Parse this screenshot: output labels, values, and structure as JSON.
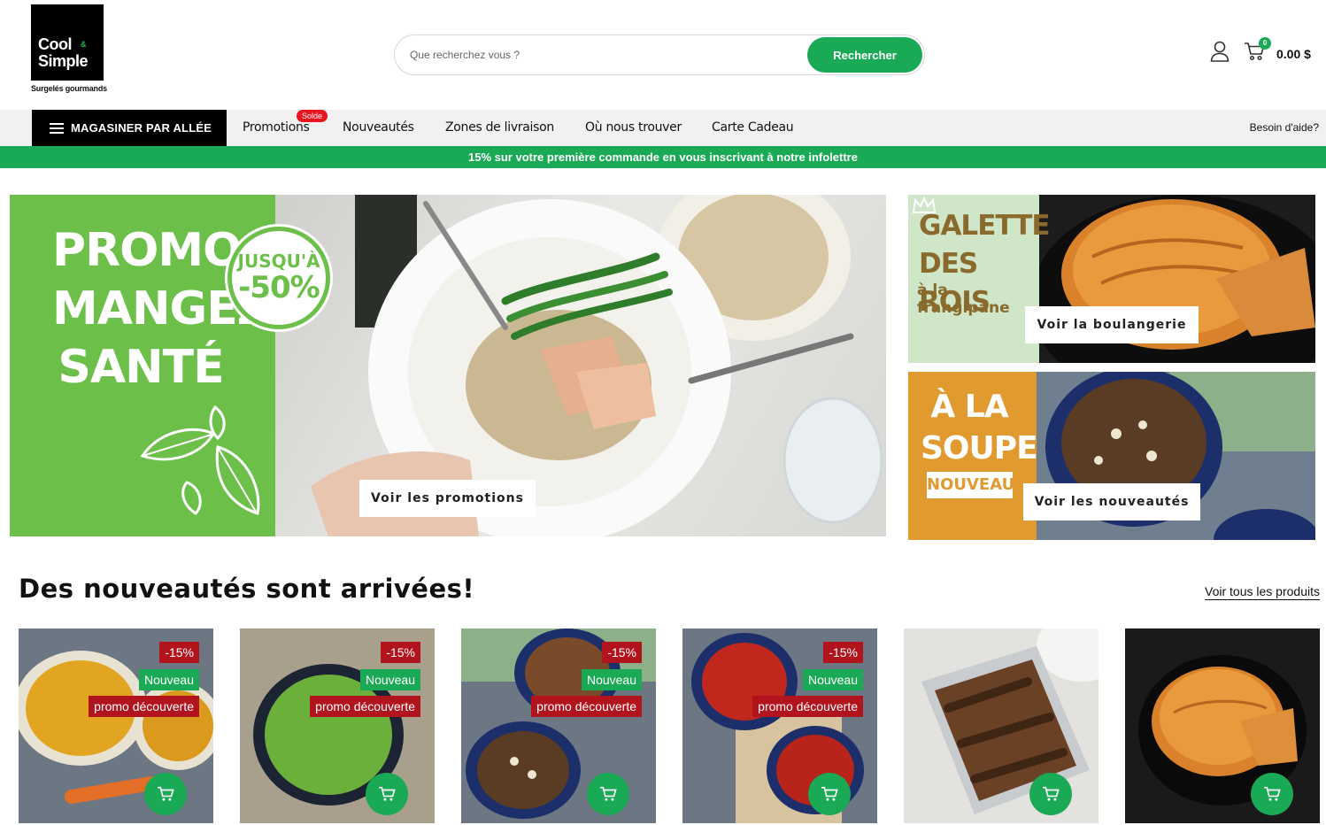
{
  "header": {
    "logo": {
      "line1": "Cool",
      "amp": "&",
      "line2": "Simple",
      "tagline": "Surgelés gourmands"
    },
    "search": {
      "placeholder": "Que recherchez vous ?",
      "button_label": "Rechercher"
    },
    "cart": {
      "count": "0",
      "total": "0.00 $"
    },
    "icons": {
      "account": "user-icon",
      "cart": "cart-icon",
      "menu": "hamburger-icon",
      "add_to_cart": "cart-icon"
    }
  },
  "nav": {
    "aisle_label": "MAGASINER PAR ALLÉE",
    "items": [
      {
        "label": "Promotions",
        "badge": "Solde"
      },
      {
        "label": "Nouveautés"
      },
      {
        "label": "Zones de livraison"
      },
      {
        "label": "Où nous trouver"
      },
      {
        "label": "Carte Cadeau"
      }
    ],
    "help_label": "Besoin d'aide?"
  },
  "promo_strip": "15% sur votre première commande en vous inscrivant à notre infolettre",
  "banners": {
    "main": {
      "title_lines": [
        "PROMOS",
        "MANGEZ",
        "SANTÉ"
      ],
      "circle_line1": "JUSQU'À",
      "circle_line2": "-50%",
      "button_label": "Voir les promotions"
    },
    "bakery": {
      "title_lines": [
        "GALETTE",
        "DES ROIS"
      ],
      "subtitle": "à la frangipane",
      "button_label": "Voir la boulangerie"
    },
    "soup": {
      "title_lines": [
        "À LA",
        "SOUPE!"
      ],
      "badge": "NOUVEAU",
      "button_label": "Voir les nouveautés"
    }
  },
  "section": {
    "title": "Des nouveautés sont arrivées!",
    "see_all_label": "Voir tous les produits"
  },
  "products": [
    {
      "discount": "-15%",
      "new_label": "Nouveau",
      "promo_label": "promo découverte",
      "bg": "#e2a521"
    },
    {
      "discount": "-15%",
      "new_label": "Nouveau",
      "promo_label": "promo découverte",
      "bg": "#6ab03a"
    },
    {
      "discount": "-15%",
      "new_label": "Nouveau",
      "promo_label": "promo découverte",
      "bg": "#5a3b24"
    },
    {
      "discount": "-15%",
      "new_label": "Nouveau",
      "promo_label": "promo découverte",
      "bg": "#c0281e"
    },
    {
      "bg": "#5b3a22"
    },
    {
      "bg": "#e07a2a"
    }
  ],
  "colors": {
    "brand_green": "#1aaa55",
    "promo_red": "#b2141e",
    "badge_red": "#e8141e",
    "banner_green": "#6cc04a",
    "banner_orange": "#e09a2f"
  }
}
